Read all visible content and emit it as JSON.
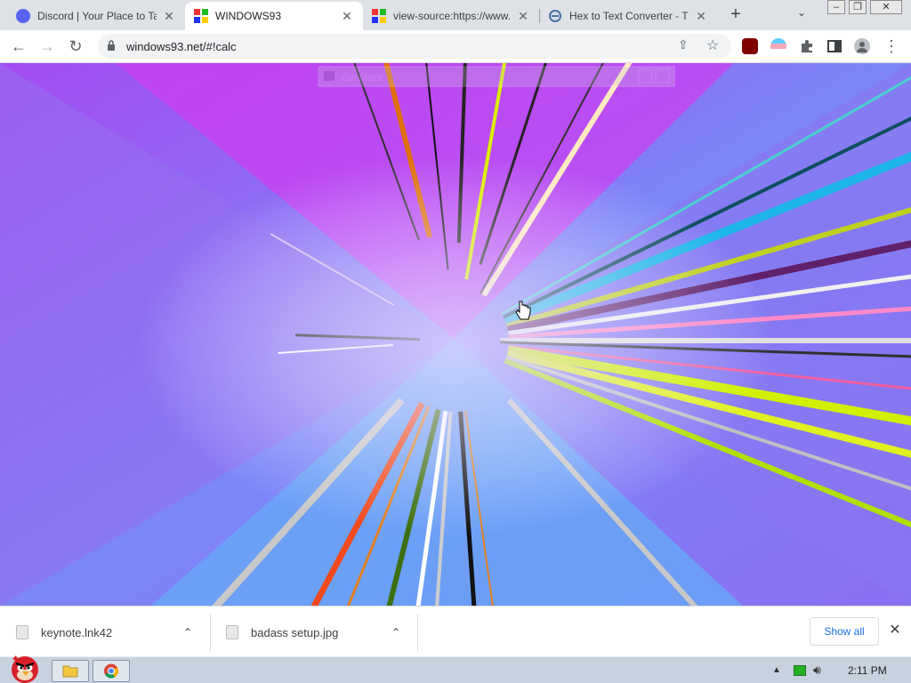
{
  "browser": {
    "tabs": [
      {
        "title": "Discord | Your Place to Ta",
        "favicon": "discord-icon",
        "color": "#5865f2",
        "active": false
      },
      {
        "title": "WINDOWS93",
        "favicon": "windows93-icon",
        "color": "#e8c100",
        "active": true
      },
      {
        "title": "view-source:https://www.",
        "favicon": "windows93-icon",
        "color": "#e8c100",
        "active": false
      },
      {
        "title": "Hex to Text Converter - T",
        "favicon": "converter-icon",
        "color": "#4a6fa5",
        "active": false
      }
    ],
    "tab_close_glyph": "✕",
    "new_tab_glyph": "+",
    "tab_search_glyph": "⌄",
    "window_controls": {
      "minimize": "–",
      "maximize": "❐",
      "close": "✕"
    },
    "nav": {
      "back": "←",
      "forward": "→",
      "reload": "↻"
    },
    "omnibox": {
      "url": "windows93.net/#!calc",
      "share_glyph": "⇪",
      "star_glyph": "☆"
    },
    "menu_glyph": "⋮"
  },
  "page": {
    "ghost_window_title": "calculator",
    "colors": {
      "magenta": "#c23ef2",
      "blue": "#6f8cf5",
      "cyan": "#5fb7f7",
      "violet": "#8f72f0"
    }
  },
  "downloads": {
    "items": [
      {
        "name": "keynote.lnk42"
      },
      {
        "name": "badass setup.jpg"
      }
    ],
    "caret_glyph": "⌃",
    "show_all": "Show all",
    "close_glyph": "✕"
  },
  "taskbar": {
    "time": "2:11 PM"
  }
}
